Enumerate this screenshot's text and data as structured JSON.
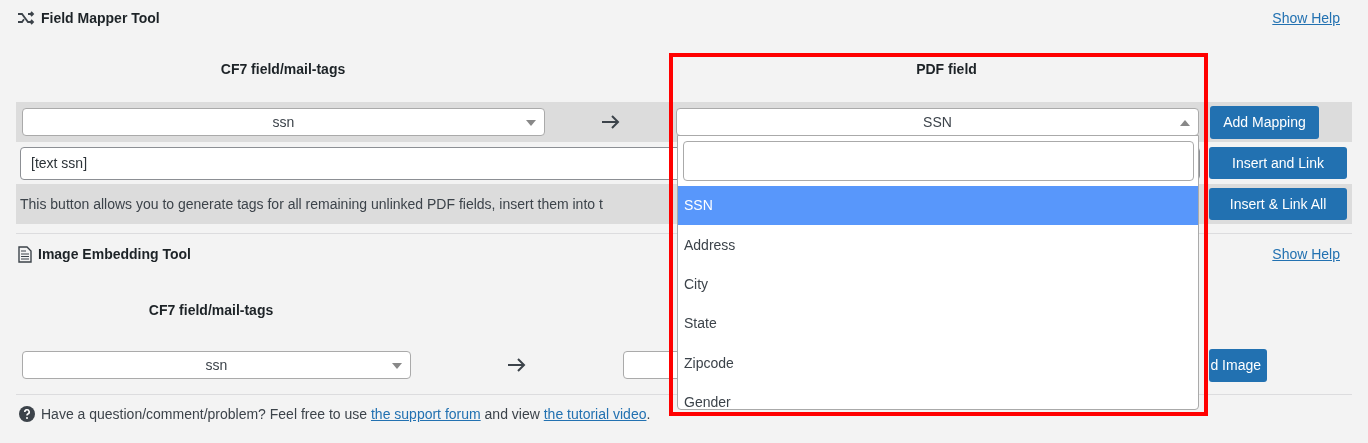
{
  "field_mapper": {
    "title": "Field Mapper Tool",
    "help_link": "Show Help",
    "cf7_header": "CF7 field/mail-tags",
    "pdf_header": "PDF field",
    "cf7_select": {
      "value": "ssn"
    },
    "pdf_select": {
      "value": "SSN",
      "expanded": true
    },
    "add_button": "Add Mapping",
    "tag_input": {
      "value": "[text ssn]"
    },
    "insert_button": "Insert and Link",
    "info_text": "This button allows you to generate tags for all remaining unlinked PDF fields, insert them into t",
    "insert_all_button": "Insert & Link All"
  },
  "image_tool": {
    "title": "Image Embedding Tool",
    "help_link": "Show Help",
    "cf7_header": "CF7 field/mail-tags",
    "cf7_select": {
      "value": "ssn"
    },
    "embed_button": "d Image"
  },
  "footer": [
    {
      "kind": "text",
      "text": "Have a question/comment/problem? Feel free to use "
    },
    {
      "kind": "link",
      "text": "the support forum"
    },
    {
      "kind": "text",
      "text": " and view "
    },
    {
      "kind": "link",
      "text": "the tutorial video"
    },
    {
      "kind": "text",
      "text": "."
    }
  ],
  "dropdown_options": [
    {
      "label": "SSN",
      "selected": true
    },
    {
      "label": "Address",
      "selected": false
    },
    {
      "label": "City",
      "selected": false
    },
    {
      "label": "State",
      "selected": false
    },
    {
      "label": "Zipcode",
      "selected": false
    },
    {
      "label": "Gender",
      "selected": false
    }
  ]
}
